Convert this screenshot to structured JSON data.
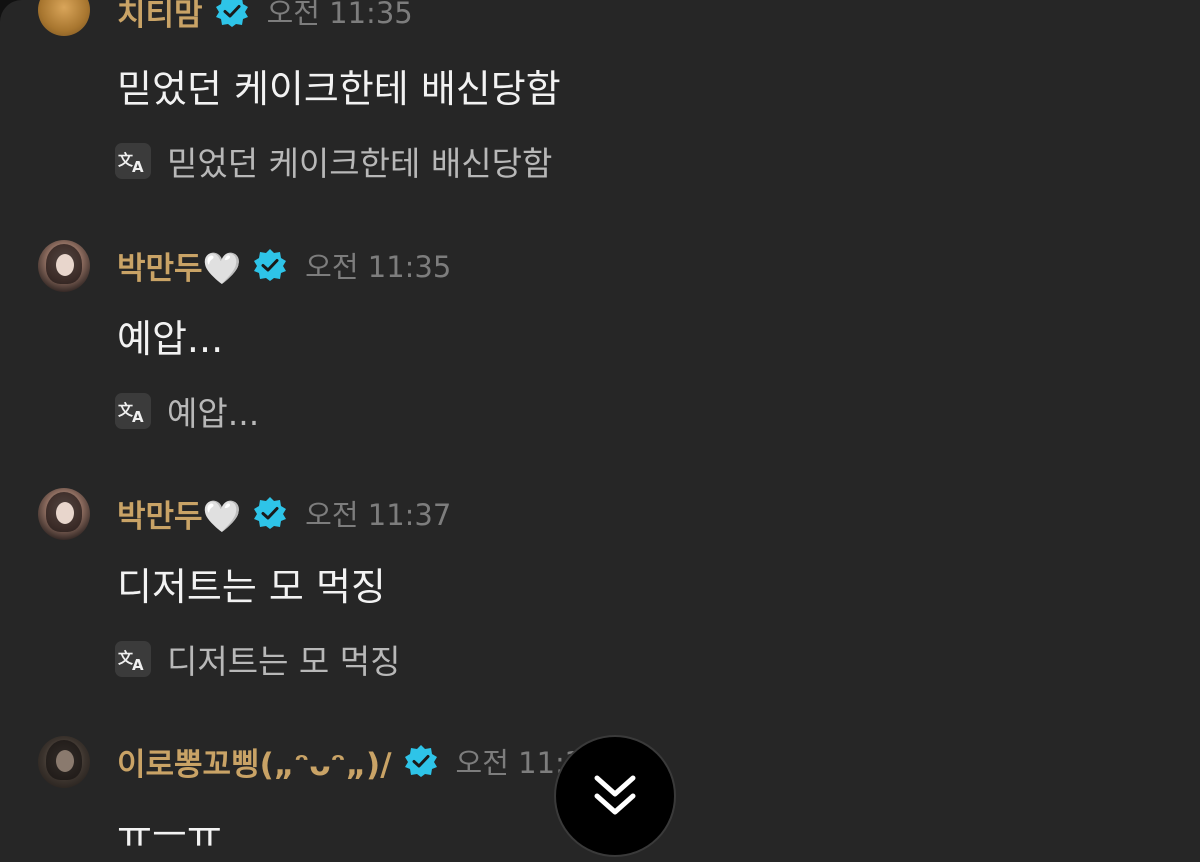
{
  "messages": [
    {
      "author": "치티맘",
      "time": "오전 11:35",
      "text": "믿었던 케이크한테 배신당함",
      "translation": "믿었던 케이크한테 배신당함"
    },
    {
      "author": "박만두🤍",
      "time": "오전 11:35",
      "text": "예압...",
      "translation": "예압..."
    },
    {
      "author": "박만두🤍",
      "time": "오전 11:37",
      "text": "디저트는 모 먹징",
      "translation": "디저트는 모 먹징"
    },
    {
      "author": "이로뽕꼬삥(„ᵔᴗᵔ„)/",
      "time": "오전 11:37",
      "text": "ㅠㅡㅠ"
    }
  ],
  "colors": {
    "background": "#262626",
    "author_name": "#c9a366",
    "verified_badge": "#2ec4e8",
    "message_text": "#f2f2f2",
    "timestamp": "#7d7d7d"
  },
  "icons": {
    "verified": "verified-badge-icon",
    "translate": "translate-icon",
    "scroll_down": "double-chevron-down-icon"
  }
}
